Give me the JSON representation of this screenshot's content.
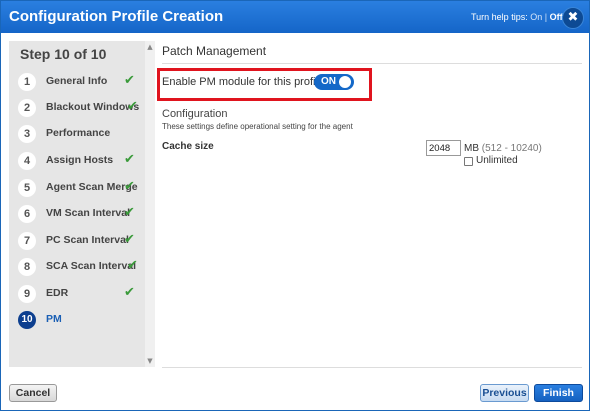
{
  "window": {
    "title": "Configuration Profile Creation",
    "help_tips": {
      "label": "Turn help tips:",
      "on": "On",
      "separator": "|",
      "off": "Off"
    },
    "close_glyph": "✖"
  },
  "sidebar": {
    "header": "Step 10 of 10",
    "steps": [
      {
        "num": "1",
        "label": "General Info",
        "check": "✔"
      },
      {
        "num": "2",
        "label": "Blackout Windows",
        "check": "✔"
      },
      {
        "num": "3",
        "label": "Performance",
        "check": ""
      },
      {
        "num": "4",
        "label": "Assign Hosts",
        "check": "✔"
      },
      {
        "num": "5",
        "label": "Agent Scan Merge",
        "check": "✔"
      },
      {
        "num": "6",
        "label": "VM Scan Interval",
        "check": "✔"
      },
      {
        "num": "7",
        "label": "PC Scan Interval",
        "check": "✔"
      },
      {
        "num": "8",
        "label": "SCA Scan Interval",
        "check": "✔"
      },
      {
        "num": "9",
        "label": "EDR",
        "check": "✔"
      },
      {
        "num": "10",
        "label": "PM",
        "check": ""
      }
    ],
    "active_step": 10,
    "scroll_up_glyph": "▲",
    "scroll_down_glyph": "▼"
  },
  "main": {
    "section_title": "Patch Management",
    "pm_toggle": {
      "label": "Enable PM module for this profile",
      "state": "ON"
    },
    "configuration": {
      "title": "Configuration",
      "description": "These settings define operational setting for the agent"
    },
    "cache_size": {
      "label": "Cache size",
      "value": "2048",
      "unit": "MB",
      "range": "(512 - 10240)",
      "unlimited_label": "Unlimited",
      "unlimited_checked": false
    }
  },
  "footer": {
    "cancel_label": "Cancel",
    "previous_label": "Previous",
    "finish_label": "Finish"
  },
  "colors": {
    "titlebar": "#1a6fd0",
    "highlight_border": "#e0141e",
    "toggle_on": "#1468c8",
    "check": "#3a9a3a",
    "active_step": "#0d3f8f"
  }
}
